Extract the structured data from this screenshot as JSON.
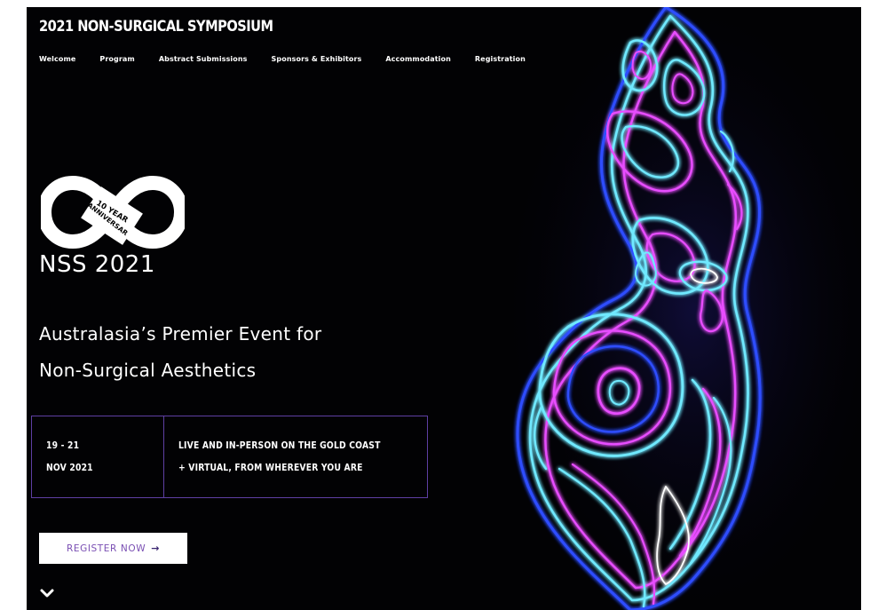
{
  "header": {
    "title": "2021 NON-SURGICAL SYMPOSIUM",
    "nav": [
      {
        "label": "Welcome"
      },
      {
        "label": "Program"
      },
      {
        "label": "Abstract Submissions"
      },
      {
        "label": "Sponsors & Exhibitors"
      },
      {
        "label": "Accommodation"
      },
      {
        "label": "Registration"
      }
    ]
  },
  "hero": {
    "logo": {
      "badge_line1": "10 YEAR",
      "badge_line2": "ANNIVERSARY",
      "icon": "infinity-logo-icon"
    },
    "event_name": "NSS 2021",
    "tagline_line1": "Australasia’s Premier Event for",
    "tagline_line2": "Non-Surgical Aesthetics",
    "dates_line1": "19 - 21",
    "dates_line2": "NOV 2021",
    "where_line1": "LIVE AND IN-PERSON ON THE GOLD COAST",
    "where_line2": "+ VIRTUAL, FROM WHEREVER YOU ARE",
    "register_label": "REGISTER NOW",
    "register_icon": "arrow-right-icon",
    "scroll_icon": "chevron-down-icon"
  },
  "colors": {
    "background": "#020204",
    "border_accent": "#5e3fa3",
    "button_text": "#7a4fb3",
    "neon_cyan": "#6fe9ff",
    "neon_magenta": "#e84dff",
    "neon_blue": "#2f4dff"
  }
}
